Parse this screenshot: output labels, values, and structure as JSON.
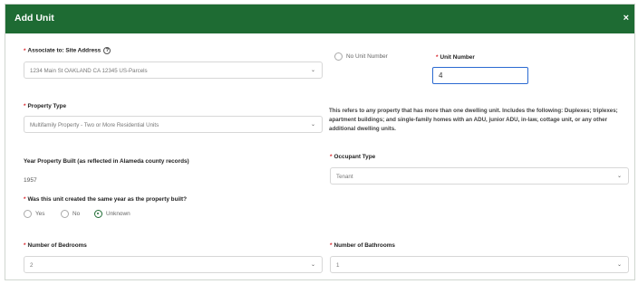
{
  "dialog": {
    "title": "Add Unit",
    "close_glyph": "×"
  },
  "site_address": {
    "required_mark": "*",
    "label": "Associate to: Site Address",
    "help_glyph": "?",
    "value": "1234 Main St OAKLAND CA 12345 US-Parcels",
    "chevron": "⌄"
  },
  "no_unit_number": {
    "label": "No Unit Number",
    "checked": false
  },
  "unit_number": {
    "required_mark": "*",
    "label": "Unit Number",
    "value": "4"
  },
  "property_type": {
    "required_mark": "*",
    "label": "Property Type",
    "value": "Multifamily Property - Two or More Residential Units",
    "chevron": "⌄"
  },
  "property_type_info": "This refers to any property that has more than one dwelling unit. Includes the following: Duplexes; triplexes; apartment buildings; and single-family homes with an ADU, junior ADU, in-law, cottage unit, or any other additional dwelling units.",
  "year_built": {
    "label": "Year Property Built (as reflected in Alameda county records)",
    "value": "1957"
  },
  "occupant_type": {
    "required_mark": "*",
    "label": "Occupant Type",
    "value": "Tenant",
    "chevron": "⌄"
  },
  "same_year": {
    "required_mark": "*",
    "label": "Was this unit created the same year as the property built?",
    "options": [
      "Yes",
      "No",
      "Unknown"
    ],
    "selected": "Unknown"
  },
  "bedrooms": {
    "required_mark": "*",
    "label": "Number of Bedrooms",
    "value": "2",
    "chevron": "⌄"
  },
  "bathrooms": {
    "required_mark": "*",
    "label": "Number of Bathrooms",
    "value": "1",
    "chevron": "⌄"
  },
  "colors": {
    "header": "#1e6b33",
    "required": "#d9232a",
    "focus": "#2b6ad1"
  }
}
